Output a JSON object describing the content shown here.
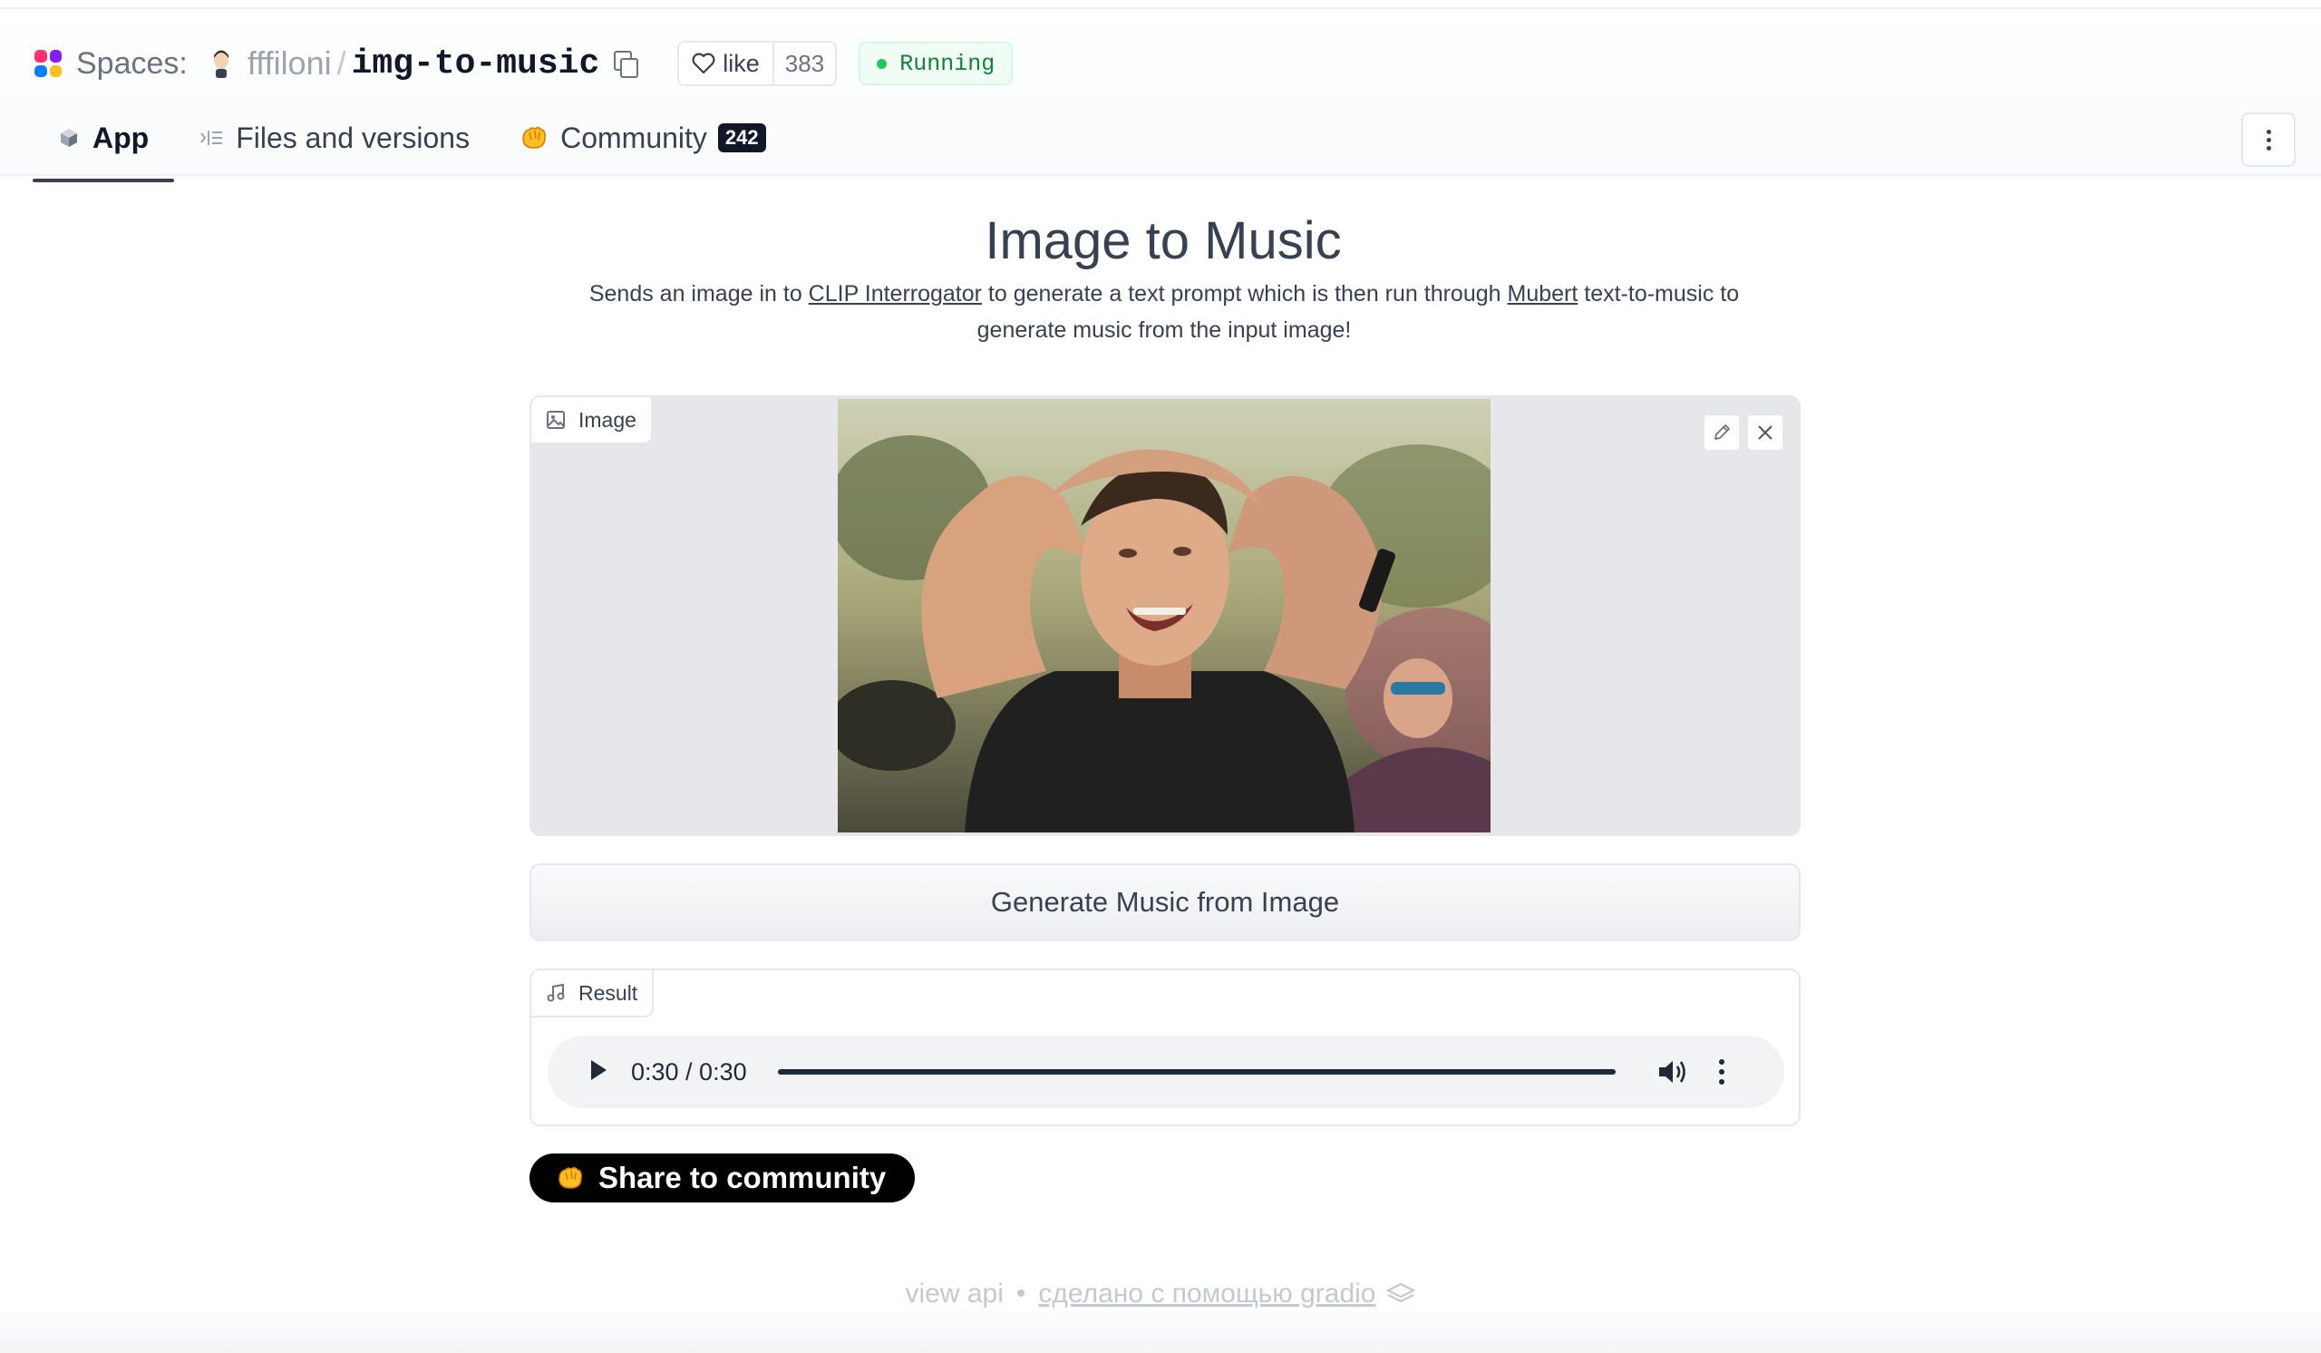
{
  "header": {
    "spaces_label": "Spaces:",
    "owner": "fffiloni",
    "separator": "/",
    "repo": "img-to-music",
    "like_label": "like",
    "like_count": "383",
    "status": "Running",
    "status_color": "#22c55e"
  },
  "tabs": [
    {
      "label": "App",
      "icon": "app-cube-icon",
      "active": true
    },
    {
      "label": "Files and versions",
      "icon": "files-icon",
      "active": false
    },
    {
      "label": "Community",
      "icon": "community-hands-icon",
      "badge": "242",
      "active": false
    }
  ],
  "app": {
    "title": "Image to Music",
    "desc_before": "Sends an image in to ",
    "desc_link1": "CLIP Interrogator",
    "desc_mid": " to generate a text prompt which is then run through ",
    "desc_link2": "Mubert",
    "desc_after": " text-to-music to generate music from the input image!",
    "image_label": "Image",
    "generate_button": "Generate Music from Image",
    "result_label": "Result",
    "audio_time": "0:30 / 0:30",
    "audio_progress": 1.0,
    "share_button": "Share to community"
  },
  "footer": {
    "view_api": "view api",
    "dot": "•",
    "made_with": "сделано с помощью gradio"
  }
}
